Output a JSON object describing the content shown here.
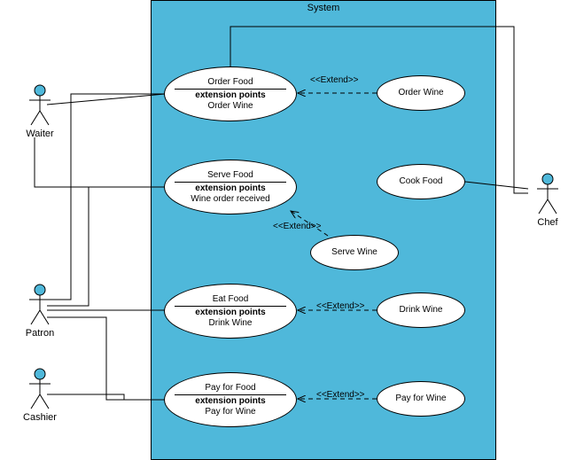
{
  "diagram_type": "uml-use-case",
  "system": {
    "title": "System"
  },
  "actors": {
    "waiter": {
      "label": "Waiter"
    },
    "patron": {
      "label": "Patron"
    },
    "cashier": {
      "label": "Cashier"
    },
    "chef": {
      "label": "Chef"
    }
  },
  "usecases": {
    "order_food": {
      "title": "Order Food",
      "ext_header": "extension points",
      "ext": "Order Wine"
    },
    "serve_food": {
      "title": "Serve Food",
      "ext_header": "extension points",
      "ext": "Wine order received"
    },
    "eat_food": {
      "title": "Eat Food",
      "ext_header": "extension points",
      "ext": "Drink Wine"
    },
    "pay_for_food": {
      "title": "Pay for Food",
      "ext_header": "extension points",
      "ext": "Pay for Wine"
    },
    "order_wine": {
      "title": "Order Wine"
    },
    "cook_food": {
      "title": "Cook Food"
    },
    "serve_wine": {
      "title": "Serve Wine"
    },
    "drink_wine": {
      "title": "Drink Wine"
    },
    "pay_for_wine": {
      "title": "Pay for Wine"
    }
  },
  "labels": {
    "extend": "<<Extend>>"
  },
  "chart_data": {
    "type": "uml-use-case-diagram",
    "system": "System",
    "actors": [
      "Waiter",
      "Patron",
      "Cashier",
      "Chef"
    ],
    "use_cases": [
      {
        "name": "Order Food",
        "extension_points": [
          "Order Wine"
        ]
      },
      {
        "name": "Serve Food",
        "extension_points": [
          "Wine order received"
        ]
      },
      {
        "name": "Eat Food",
        "extension_points": [
          "Drink Wine"
        ]
      },
      {
        "name": "Pay for Food",
        "extension_points": [
          "Pay for Wine"
        ]
      },
      {
        "name": "Order Wine"
      },
      {
        "name": "Cook Food"
      },
      {
        "name": "Serve Wine"
      },
      {
        "name": "Drink Wine"
      },
      {
        "name": "Pay for Wine"
      }
    ],
    "associations": [
      {
        "actor": "Waiter",
        "use_case": "Order Food"
      },
      {
        "actor": "Waiter",
        "use_case": "Serve Food"
      },
      {
        "actor": "Patron",
        "use_case": "Order Food"
      },
      {
        "actor": "Patron",
        "use_case": "Serve Food"
      },
      {
        "actor": "Patron",
        "use_case": "Eat Food"
      },
      {
        "actor": "Patron",
        "use_case": "Pay for Food"
      },
      {
        "actor": "Cashier",
        "use_case": "Pay for Food"
      },
      {
        "actor": "Chef",
        "use_case": "Order Food"
      },
      {
        "actor": "Chef",
        "use_case": "Cook Food"
      }
    ],
    "extends": [
      {
        "extension": "Order Wine",
        "base": "Order Food"
      },
      {
        "extension": "Serve Wine",
        "base": "Serve Food"
      },
      {
        "extension": "Drink Wine",
        "base": "Eat Food"
      },
      {
        "extension": "Pay for Wine",
        "base": "Pay for Food"
      }
    ]
  }
}
